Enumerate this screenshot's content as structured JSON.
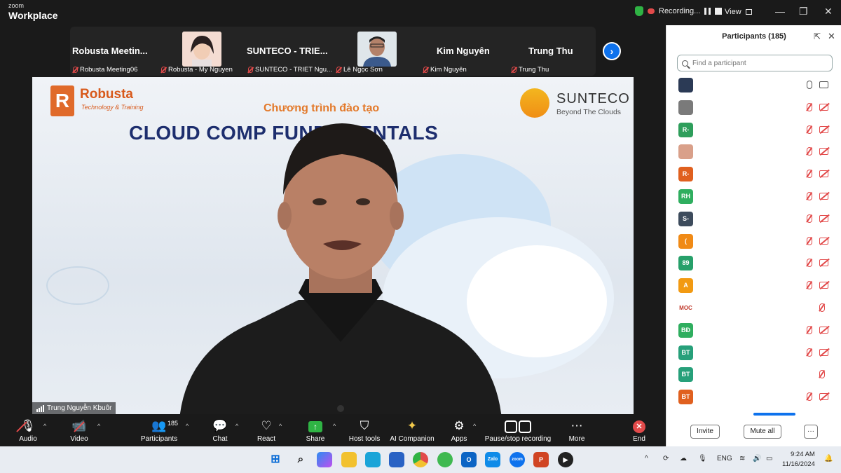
{
  "titlebar": {
    "brand_small": "zoom",
    "brand_large": "Workplace",
    "recording_label": "Recording...",
    "view_label": "View",
    "window_controls": [
      "—",
      "❐",
      "✕"
    ]
  },
  "strip": {
    "tiles": [
      {
        "name": "Robusta  Meetin...",
        "label": "Robusta Meeting06"
      },
      {
        "name": "",
        "label": "Robusta - My Nguyen"
      },
      {
        "name": "SUNTECO  -  TRIE...",
        "label": "SUNTECO - TRIET Ngu..."
      },
      {
        "name": "",
        "label": "Lê Ngọc Sơn"
      },
      {
        "name": "Kim Nguyên",
        "label": "Kim Nguyên"
      },
      {
        "name": "Trung Thu",
        "label": "Trung Thu"
      }
    ],
    "next_icon": "chevron-right-icon"
  },
  "video": {
    "left_logo_title": "Robusta",
    "left_logo_sub": "Technology & Training",
    "right_logo_title": "SUNTECO",
    "right_logo_sub": "Beyond The Clouds",
    "subtitle": "Chương trình đào tạo",
    "title": "CLOUD COMP        FUNDAMENTALS",
    "speaker_name": "Trung Nguyễn Kbuôr"
  },
  "toolbar": {
    "audio": "Audio",
    "video": "Video",
    "participants": "Participants",
    "participants_count": "185",
    "chat": "Chat",
    "react": "React",
    "share": "Share",
    "host_tools": "Host tools",
    "ai_companion": "AI Companion",
    "apps": "Apps",
    "pause_stop": "Pause/stop recording",
    "more": "More",
    "end": "End"
  },
  "panel": {
    "title": "Participants (185)",
    "search_placeholder": "Find a participant",
    "invite": "Invite",
    "mute_all": "Mute all",
    "more": "···",
    "participants": [
      {
        "initials": "",
        "color": "#2b3a55",
        "mic": "on",
        "cam": "on"
      },
      {
        "initials": "",
        "color": "#7a7a7a",
        "mic": "off",
        "cam": "off"
      },
      {
        "initials": "R-",
        "color": "#2e9e5b",
        "mic": "off",
        "cam": "off"
      },
      {
        "initials": "",
        "color": "#d9a08a",
        "mic": "off",
        "cam": "off"
      },
      {
        "initials": "R-",
        "color": "#e0601f",
        "mic": "off",
        "cam": "off"
      },
      {
        "initials": "RH",
        "color": "#2fae5f",
        "mic": "off",
        "cam": "off"
      },
      {
        "initials": "S-",
        "color": "#3d4b5c",
        "mic": "off",
        "cam": "off"
      },
      {
        "initials": "(",
        "color": "#f08a16",
        "mic": "off",
        "cam": "off"
      },
      {
        "initials": "89",
        "color": "#27a06a",
        "mic": "off",
        "cam": "off"
      },
      {
        "initials": "A",
        "color": "#f29a12",
        "mic": "off",
        "cam": "off"
      },
      {
        "initials": "MOC",
        "color": "#ffffff",
        "mic": "off",
        "cam": "none"
      },
      {
        "initials": "BĐ",
        "color": "#2fae5f",
        "mic": "off",
        "cam": "off"
      },
      {
        "initials": "BT",
        "color": "#27a07a",
        "mic": "off",
        "cam": "off"
      },
      {
        "initials": "BT",
        "color": "#27a07a",
        "mic": "off",
        "cam": "none"
      },
      {
        "initials": "BT",
        "color": "#e0601f",
        "mic": "off",
        "cam": "off"
      }
    ]
  },
  "taskbar": {
    "language": "ENG",
    "time": "9:24 AM",
    "date": "11/16/2024"
  }
}
